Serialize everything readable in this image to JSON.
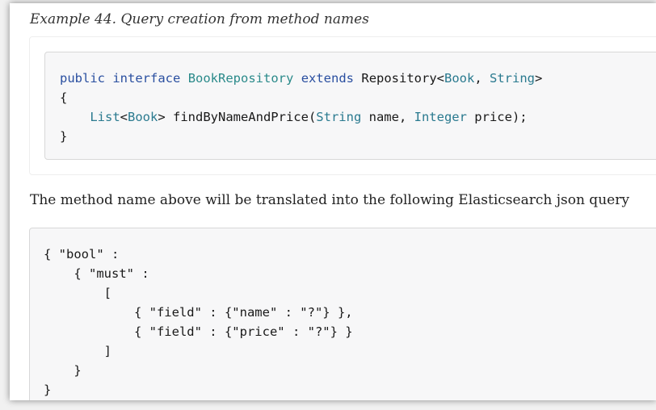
{
  "example": {
    "title": "Example 44. Query creation from method names"
  },
  "java_code": {
    "line1": {
      "kw_public": "public",
      "kw_interface": "interface",
      "class_name": "BookRepository",
      "kw_extends": "extends",
      "base": "Repository<",
      "generic_book": "Book",
      "comma": ", ",
      "generic_string": "String",
      "close": ">"
    },
    "line2": "{",
    "line3": {
      "indent": "    ",
      "type_list": "List",
      "lt": "<",
      "type_book": "Book",
      "gt_method": "> findByNameAndPrice(",
      "type_string": "String",
      "param_name": " name, ",
      "type_integer": "Integer",
      "param_price": " price);"
    },
    "line4": "}"
  },
  "description": "The method name above will be translated into the following Elasticsearch json query",
  "json_code": "{ \"bool\" :\n    { \"must\" :\n        [\n            { \"field\" : {\"name\" : \"?\"} },\n            { \"field\" : {\"price\" : \"?\"} }\n        ]\n    }\n}"
}
